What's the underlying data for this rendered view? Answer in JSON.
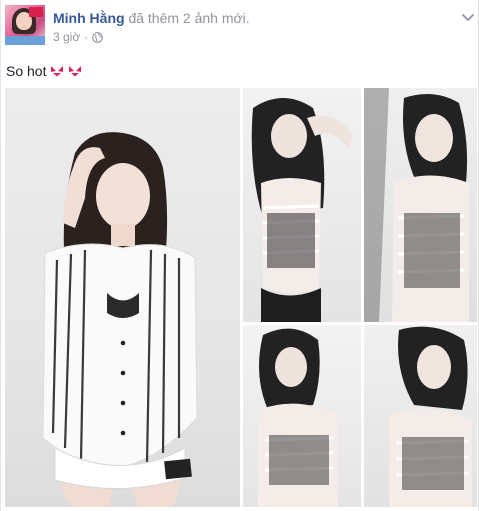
{
  "post": {
    "author_name": "Minh Hằng",
    "action_text": "đã thêm 2 ảnh mới.",
    "timestamp": "3 giờ",
    "privacy_icon": "globe-icon",
    "menu_icon": "chevron-down-icon",
    "text": "So hot",
    "text_emoji": [
      "bikini-icon",
      "bikini-icon"
    ]
  },
  "colors": {
    "author_link": "#365899",
    "meta_text": "#90949c",
    "body_text": "#1d2129"
  }
}
